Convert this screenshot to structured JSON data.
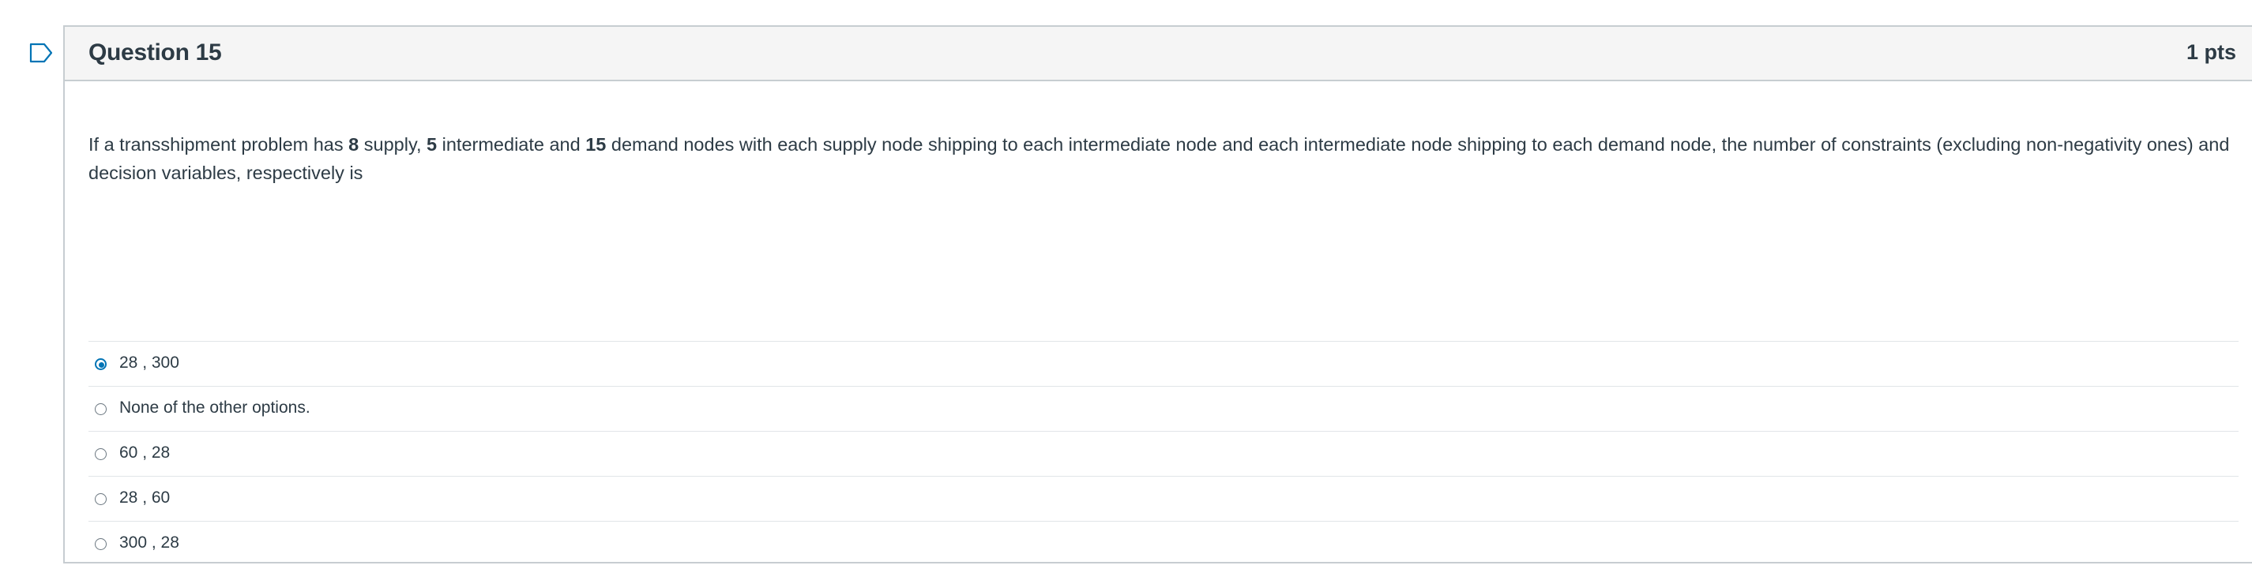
{
  "question": {
    "title": "Question 15",
    "points": "1 pts",
    "text_parts": [
      "If a transshipment problem has ",
      "8",
      " supply, ",
      "5",
      " intermediate and ",
      "15",
      " demand nodes with each supply node shipping to each intermediate node and each intermediate node shipping to each demand node, the number of constraints (excluding non-negativity ones) and decision variables, respectively is"
    ]
  },
  "answers": [
    {
      "label": "28 , 300",
      "selected": true
    },
    {
      "label": "None of the other options.",
      "selected": false
    },
    {
      "label": "60 , 28",
      "selected": false
    },
    {
      "label": "28 , 60",
      "selected": false
    },
    {
      "label": "300 , 28",
      "selected": false
    }
  ],
  "colors": {
    "accent": "#0374b5",
    "header_bg": "#f5f5f5",
    "border": "#c7cdd1",
    "text": "#2d3b45"
  }
}
